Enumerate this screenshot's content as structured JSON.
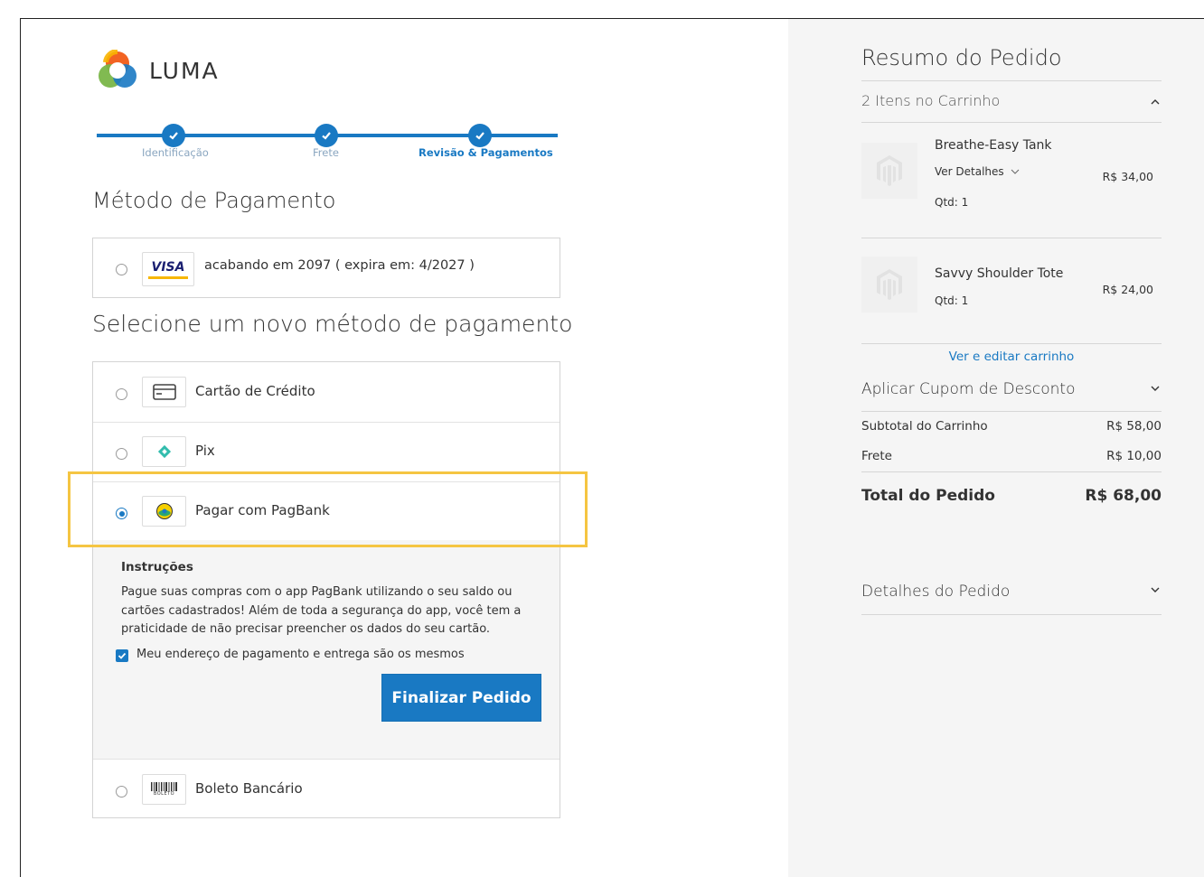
{
  "brand": {
    "name": "LUMA"
  },
  "progress": {
    "steps": [
      {
        "label": "Identificação",
        "complete": true
      },
      {
        "label": "Frete",
        "complete": true
      },
      {
        "label": "Revisão & Pagamentos",
        "complete": true,
        "active": true
      }
    ]
  },
  "payment": {
    "title": "Método de Pagamento",
    "saved_card": {
      "brand": "VISA",
      "label": "acabando em 2097 ( expira em: 4/2027 )",
      "selected": false
    },
    "new_method_title": "Selecione um novo método de pagamento",
    "methods": [
      {
        "label": "Cartão de Crédito",
        "icon": "credit-card-icon",
        "selected": false
      },
      {
        "label": "Pix",
        "icon": "pix-icon",
        "selected": false
      },
      {
        "label": "Pagar com PagBank",
        "icon": "pagbank-icon",
        "selected": true
      },
      {
        "label": "Boleto Bancário",
        "icon": "boleto-icon",
        "icon_text": "BOLETO",
        "selected": false
      }
    ],
    "instructions": {
      "title": "Instruções",
      "text": "Pague suas compras com o app PagBank utilizando o seu saldo ou cartões cadastrados! Além de toda a segurança do app, você tem a praticidade de não precisar preencher os dados do seu cartão.",
      "same_address_label": "Meu endereço de pagamento e entrega são os mesmos",
      "same_address_checked": true,
      "submit_label": "Finalizar Pedido"
    },
    "highlight_color": "#f5c542"
  },
  "summary": {
    "title": "Resumo do Pedido",
    "items_count_label": "2 Itens no Carrinho",
    "items": [
      {
        "name": "Breathe-Easy Tank",
        "details_label": "Ver Detalhes",
        "qty_label": "Qtd: 1",
        "price": "R$ 34,00"
      },
      {
        "name": "Savvy Shoulder Tote",
        "qty_label": "Qtd: 1",
        "price": "R$ 24,00"
      }
    ],
    "edit_cart_label": "Ver e editar carrinho",
    "coupon_label": "Aplicar Cupom de Desconto",
    "totals": [
      {
        "label": "Subtotal do Carrinho",
        "value": "R$ 58,00"
      },
      {
        "label": "Frete",
        "value": "R$ 10,00"
      }
    ],
    "grand_total": {
      "label": "Total do Pedido",
      "value": "R$ 68,00"
    },
    "order_details_label": "Detalhes do Pedido"
  },
  "colors": {
    "accent": "#1979c3",
    "sidebar_bg": "#f5f5f5"
  }
}
